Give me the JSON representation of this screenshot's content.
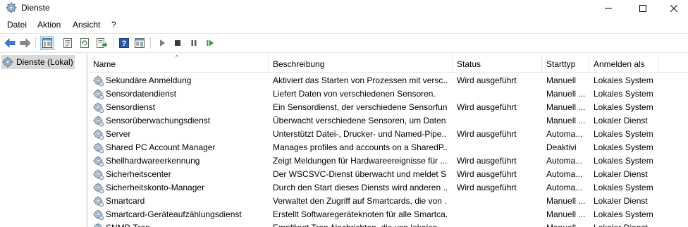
{
  "window": {
    "title": "Dienste",
    "icon": "gear-icon",
    "controls": [
      "minimize-icon",
      "maximize-icon",
      "close-icon"
    ]
  },
  "menu": [
    "Datei",
    "Aktion",
    "Ansicht",
    "?"
  ],
  "toolbar": [
    "back-arrow-icon",
    "forward-arrow-icon",
    "console-tree-icon",
    "properties-icon",
    "refresh-icon",
    "export-list-icon",
    "help-icon",
    "show-hide-action-pane-icon",
    "start-service-icon",
    "stop-service-icon",
    "pause-service-icon",
    "restart-service-icon"
  ],
  "tree": {
    "item_label": "Dienste (Lokal)"
  },
  "columns": {
    "name": "Name",
    "description": "Beschreibung",
    "status": "Status",
    "startup": "Starttyp",
    "logon": "Anmelden als"
  },
  "rows": [
    {
      "name": "Sekundäre Anmeldung",
      "desc": "Aktiviert das Starten von Prozessen mit versc...",
      "status": "Wird ausgeführt",
      "start": "Manuell",
      "logon": "Lokales System"
    },
    {
      "name": "Sensordatendienst",
      "desc": "Liefert Daten von verschiedenen Sensoren.",
      "status": "",
      "start": "Manuell ...",
      "logon": "Lokales System"
    },
    {
      "name": "Sensordienst",
      "desc": "Ein Sensordienst, der verschiedene Sensorfun...",
      "status": "Wird ausgeführt",
      "start": "Manuell ...",
      "logon": "Lokales System"
    },
    {
      "name": "Sensorüberwachungsdienst",
      "desc": "Überwacht verschiedene Sensoren, um Daten...",
      "status": "",
      "start": "Manuell ...",
      "logon": "Lokaler Dienst"
    },
    {
      "name": "Server",
      "desc": "Unterstützt Datei-, Drucker- und Named-Pipe...",
      "status": "Wird ausgeführt",
      "start": "Automa...",
      "logon": "Lokales System"
    },
    {
      "name": "Shared PC Account Manager",
      "desc": "Manages profiles and accounts on a SharedP...",
      "status": "",
      "start": "Deaktivi",
      "logon": "Lokales System"
    },
    {
      "name": "Shellhardwareerkennung",
      "desc": "Zeigt Meldungen für Hardwareereignisse für ...",
      "status": "Wird ausgeführt",
      "start": "Automa...",
      "logon": "Lokales System"
    },
    {
      "name": "Sicherheitscenter",
      "desc": "Der WSCSVC-Dienst überwacht und meldet Si...",
      "status": "Wird ausgeführt",
      "start": "Automa...",
      "logon": "Lokaler Dienst"
    },
    {
      "name": "Sicherheitskonto-Manager",
      "desc": "Durch den Start dieses Diensts wird anderen ...",
      "status": "Wird ausgeführt",
      "start": "Automa...",
      "logon": "Lokales System"
    },
    {
      "name": "Smartcard",
      "desc": "Verwaltet den Zugriff auf Smartcards, die von ...",
      "status": "",
      "start": "Manuell ...",
      "logon": "Lokaler Dienst"
    },
    {
      "name": "Smartcard-Geräteaufzählungsdienst",
      "desc": "Erstellt Softwaregeräteknoten für alle Smartca...",
      "status": "",
      "start": "Manuell ...",
      "logon": "Lokales System"
    },
    {
      "name": "SNMP-Trap",
      "desc": "Empfängt Trap-Nachrichten, die von lokalen ...",
      "status": "",
      "start": "Manuell",
      "logon": "Lokaler Dienst"
    }
  ]
}
